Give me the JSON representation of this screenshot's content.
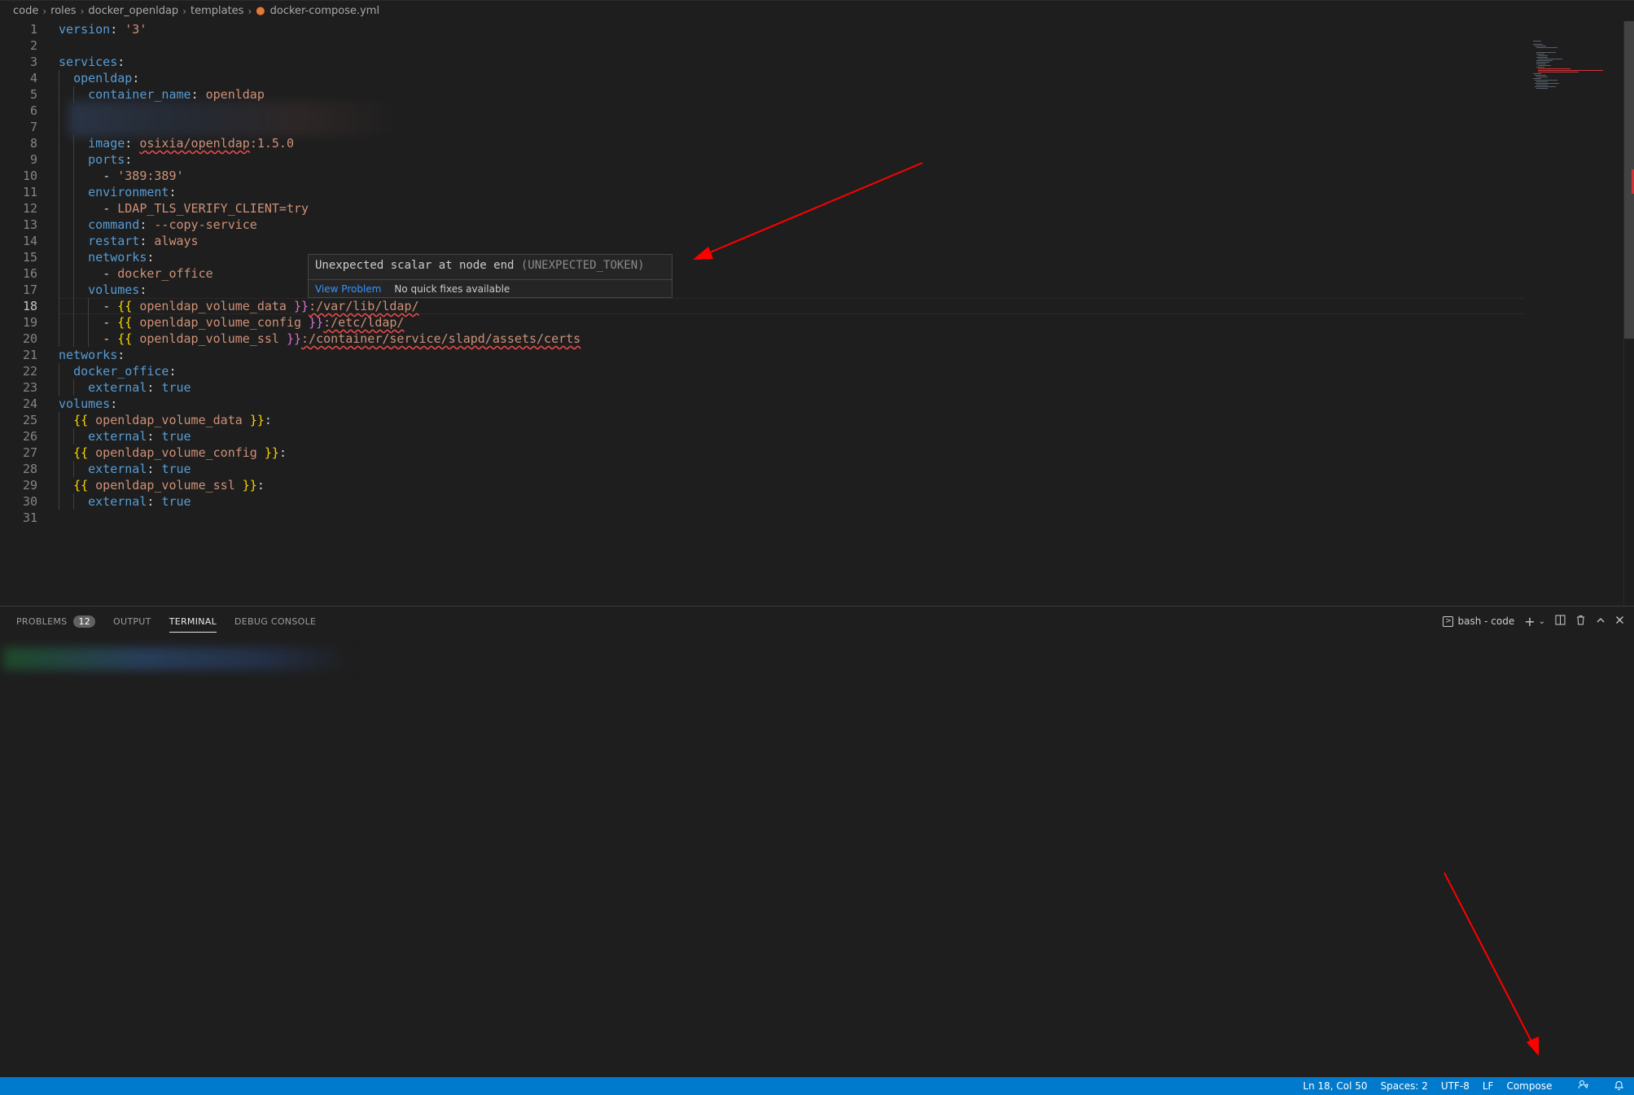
{
  "breadcrumb": [
    "code",
    "roles",
    "docker_openldap",
    "templates",
    "docker-compose.yml"
  ],
  "icons": {
    "breadcrumb_sep": "chevron-right-icon",
    "file": "docker-file-icon"
  },
  "editor": {
    "active_line": 18,
    "line_numbers": [
      "1",
      "2",
      "3",
      "4",
      "5",
      "6",
      "7",
      "8",
      "9",
      "10",
      "11",
      "12",
      "13",
      "14",
      "15",
      "16",
      "17",
      "18",
      "19",
      "20",
      "21",
      "22",
      "23",
      "24",
      "25",
      "26",
      "27",
      "28",
      "29",
      "30",
      "31"
    ],
    "t": {
      "version_key": "version",
      "version_val": "'3'",
      "services": "services",
      "openldap": "openldap",
      "container_name": "container_name",
      "container_val": "openldap",
      "image": "image",
      "image_val": "osixia/openldap",
      "image_tag": ":1.5.0",
      "ports": "ports",
      "port_val": "'389:389'",
      "environment": "environment",
      "env_val": "LDAP_TLS_VERIFY_CLIENT=try",
      "command": "command",
      "command_val": "--copy-service",
      "restart": "restart",
      "restart_val": "always",
      "networks": "networks",
      "network_item": "docker_office",
      "volumes": "volumes",
      "vol_data": "openldap_volume_data",
      "vol_data_path": ":/var/lib/ldap/",
      "vol_config": "openldap_volume_config",
      "vol_config_path": ":/etc/ldap/",
      "vol_ssl": "openldap_volume_ssl",
      "vol_ssl_path": ":/container/service/slapd/assets/certs",
      "docker_office": "docker_office",
      "external": "external",
      "true": "true",
      "dash": "-",
      "colon": ":",
      "ob": "{{",
      "cb": "}}"
    }
  },
  "hover": {
    "message": "Unexpected scalar at node end",
    "code": "(UNEXPECTED_TOKEN)",
    "view_problem": "View Problem",
    "no_fixes": "No quick fixes available"
  },
  "panel": {
    "tabs": [
      {
        "label": "PROBLEMS",
        "badge": "12"
      },
      {
        "label": "OUTPUT"
      },
      {
        "label": "TERMINAL",
        "active": true
      },
      {
        "label": "DEBUG CONSOLE"
      }
    ],
    "terminal_name": "bash - code",
    "icons": [
      "terminal-icon",
      "plus-icon",
      "chevron-down-icon",
      "split-icon",
      "trash-icon",
      "chevron-up-icon",
      "close-icon"
    ]
  },
  "statusbar": {
    "position": "Ln 18, Col 50",
    "spaces": "Spaces: 2",
    "encoding": "UTF-8",
    "eol": "LF",
    "language": "Compose",
    "icons": [
      "feedback-icon",
      "bell-icon"
    ]
  },
  "colors": {
    "statusbar": "#007acc",
    "editor_bg": "#1e1e1e",
    "error": "#f14c4c",
    "arrow": "#ff0000"
  }
}
